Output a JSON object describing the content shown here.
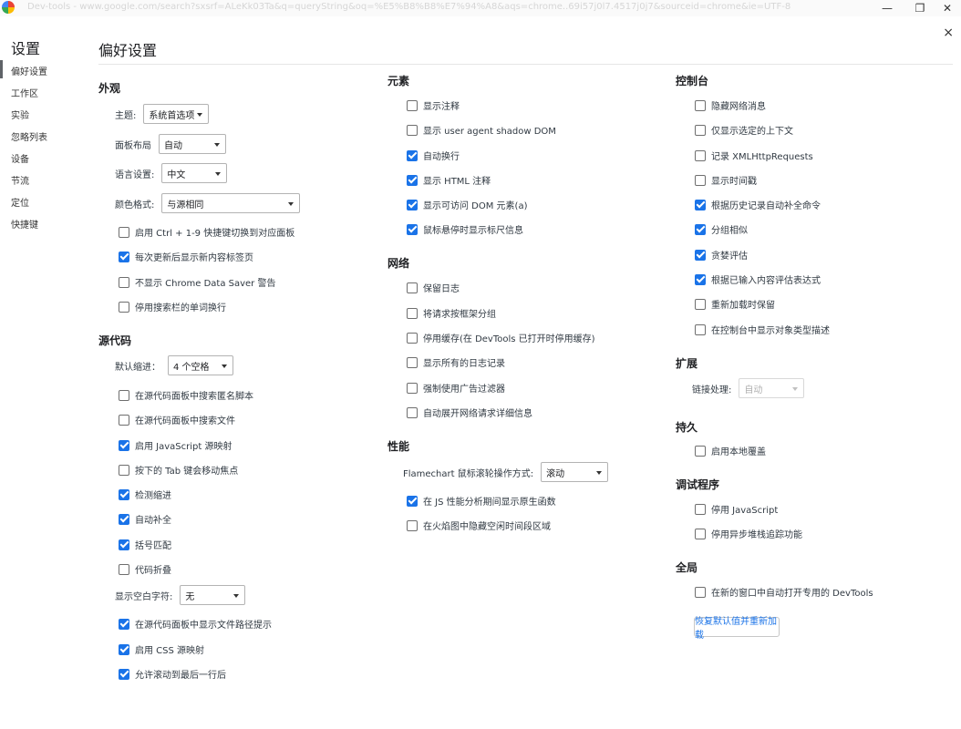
{
  "window": {
    "url": "Dev-tools - www.google.com/search?sxsrf=ALeKk03Ta&q=queryString&oq=%E5%B8%B8%E7%94%A8&aqs=chrome..69i57j0l7.4517j0j7&sourceid=chrome&ie=UTF-8",
    "minimize_label": "—",
    "maximize_label": "❐",
    "close_label": "✕"
  },
  "panel_close_label": "×",
  "sidebar": {
    "title": "设置",
    "items": [
      "偏好设置",
      "工作区",
      "实验",
      "忽略列表",
      "设备",
      "节流",
      "定位",
      "快捷键"
    ]
  },
  "page": {
    "title": "偏好设置"
  },
  "column1": {
    "appearance": {
      "title": "外观",
      "selects": [
        {
          "label": "主题:",
          "value": "系统首选项"
        },
        {
          "label": "面板布局",
          "value": "自动"
        },
        {
          "label": "语言设置:",
          "value": "中文"
        },
        {
          "label": "颜色格式:",
          "value": "与源相同"
        }
      ],
      "checkboxes": [
        {
          "label": "启用 Ctrl + 1-9 快捷键切换到对应面板",
          "checked": false
        },
        {
          "label": "每次更新后显示新内容标签页",
          "checked": true
        },
        {
          "label": "不显示 Chrome Data Saver 警告",
          "checked": false
        },
        {
          "label": "停用搜索栏的单词换行",
          "checked": false
        }
      ]
    },
    "sources": {
      "title": "源代码",
      "indent_label": "默认缩进：",
      "indent_value": "4 个空格",
      "checkboxes": [
        {
          "label": "在源代码面板中搜索匿名脚本",
          "checked": false
        },
        {
          "label": "在源代码面板中搜索文件",
          "checked": false
        },
        {
          "label": "启用 JavaScript 源映射",
          "checked": true
        },
        {
          "label": "按下的 Tab 键会移动焦点",
          "checked": false
        },
        {
          "label": "检测缩进",
          "checked": true
        },
        {
          "label": "自动补全",
          "checked": true
        },
        {
          "label": "括号匹配",
          "checked": true
        },
        {
          "label": "代码折叠",
          "checked": false
        }
      ],
      "whitespace_label": "显示空白字符:",
      "whitespace_value": "无",
      "checkboxes2": [
        {
          "label": "在源代码面板中显示文件路径提示",
          "checked": true
        },
        {
          "label": "启用 CSS 源映射",
          "checked": true
        },
        {
          "label": "允许滚动到最后一行后",
          "checked": true
        }
      ]
    }
  },
  "column2": {
    "elements": {
      "title": "元素",
      "checkboxes": [
        {
          "label": "显示注释",
          "checked": false
        },
        {
          "label": "显示 user agent shadow DOM",
          "checked": false
        },
        {
          "label": "自动换行",
          "checked": true
        },
        {
          "label": "显示 HTML 注释",
          "checked": true
        },
        {
          "label": "显示可访问 DOM 元素(a)",
          "checked": true
        },
        {
          "label": "鼠标悬停时显示标尺信息",
          "checked": true
        }
      ]
    },
    "network": {
      "title": "网络",
      "checkboxes": [
        {
          "label": "保留日志",
          "checked": false
        },
        {
          "label": "将请求按框架分组",
          "checked": false
        },
        {
          "label": "停用缓存(在 DevTools 已打开时停用缓存)",
          "checked": false
        },
        {
          "label": "显示所有的日志记录",
          "checked": false
        },
        {
          "label": "强制使用广告过滤器",
          "checked": false
        },
        {
          "label": "自动展开网络请求详细信息",
          "checked": false
        }
      ]
    },
    "performance": {
      "title": "性能",
      "select_label": "Flamechart 鼠标滚轮操作方式:",
      "select_value": "滚动",
      "checkboxes": [
        {
          "label": "在 JS 性能分析期间显示原生函数",
          "checked": true
        },
        {
          "label": "在火焰图中隐藏空闲时间段区域",
          "checked": false
        }
      ]
    }
  },
  "column3": {
    "console": {
      "title": "控制台",
      "checkboxes": [
        {
          "label": "隐藏网络消息",
          "checked": false
        },
        {
          "label": "仅显示选定的上下文",
          "checked": false
        },
        {
          "label": "记录 XMLHttpRequests",
          "checked": false
        },
        {
          "label": "显示时间戳",
          "checked": false
        },
        {
          "label": "根据历史记录自动补全命令",
          "checked": true
        },
        {
          "label": "分组相似",
          "checked": true
        },
        {
          "label": "贪婪评估",
          "checked": true
        },
        {
          "label": "根据已输入内容评估表达式",
          "checked": true
        },
        {
          "label": "重新加载时保留",
          "checked": false
        },
        {
          "label": "在控制台中显示对象类型描述",
          "checked": false
        }
      ]
    },
    "extensions": {
      "title": "扩展",
      "select_label": "链接处理:",
      "select_value": "自动"
    },
    "persistence": {
      "title": "持久",
      "checkboxes": [
        {
          "label": "启用本地覆盖",
          "checked": false
        }
      ]
    },
    "debugger": {
      "title": "调试程序",
      "checkboxes": [
        {
          "label": "停用 JavaScript",
          "checked": false
        },
        {
          "label": "停用异步堆栈追踪功能",
          "checked": false
        }
      ]
    },
    "global": {
      "title": "全局",
      "checkboxes": [
        {
          "label": "在新的窗口中自动打开专用的 DevTools",
          "checked": false
        }
      ],
      "restore_button": "恢复默认值并重新加载"
    }
  }
}
